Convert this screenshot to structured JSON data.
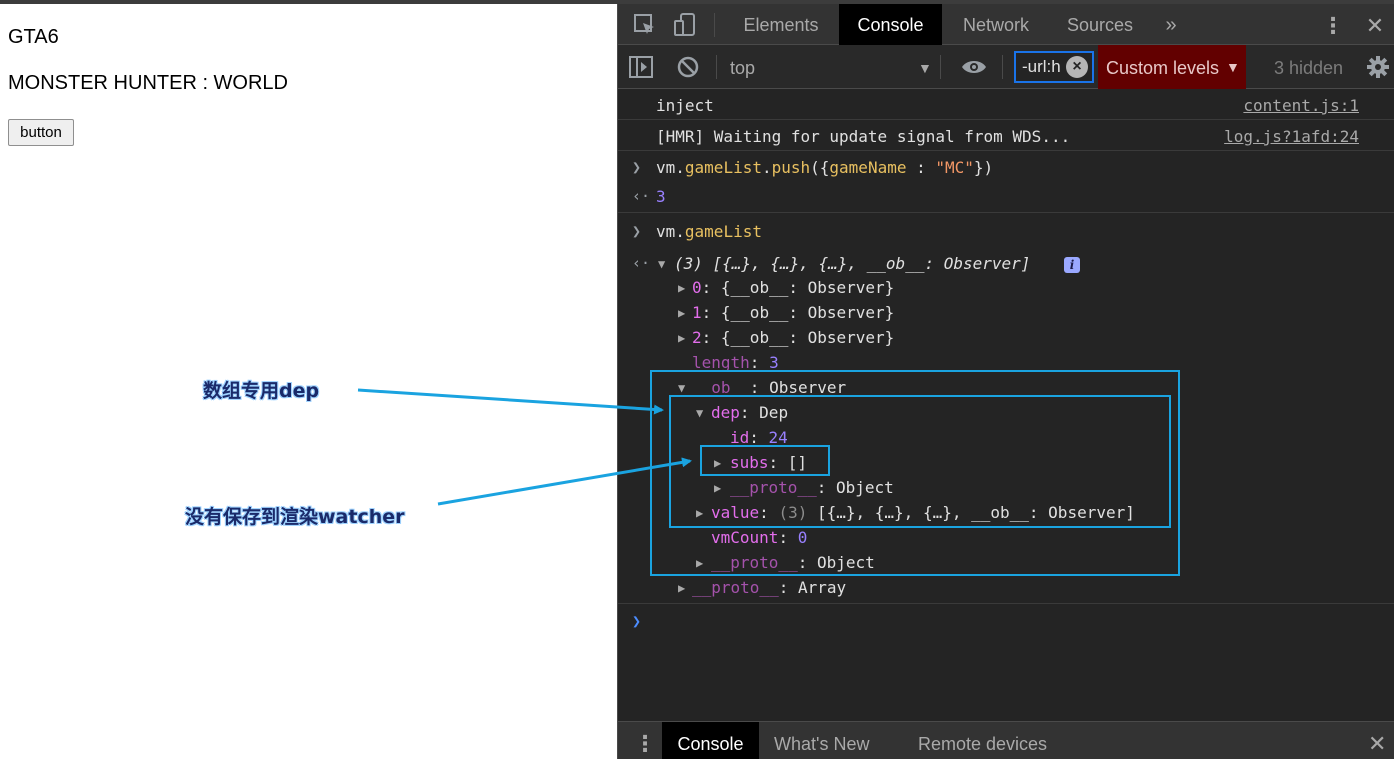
{
  "page": {
    "games": [
      "GTA6",
      "MONSTER HUNTER : WORLD"
    ],
    "button_label": "button"
  },
  "devtools": {
    "tabs": [
      "Elements",
      "Console",
      "Network",
      "Sources"
    ],
    "active_tab": "Console",
    "more_tabs_icon": "double-chevron-right-icon",
    "toolbar": {
      "context": "top",
      "filter_value": "-url:h",
      "levels_label": "Custom levels",
      "hidden_label": "3 hidden"
    },
    "console": {
      "logs": [
        {
          "message": "inject",
          "source": "content.js:1"
        },
        {
          "message": "[HMR] Waiting for update signal from WDS...",
          "source": "log.js?1afd:24"
        }
      ],
      "input1": {
        "obj": "vm.",
        "method": "gameList",
        "dot": ".",
        "call": "push",
        "args_open": "({",
        "key": "gameName",
        "colon": " : ",
        "value": "\"MC\"",
        "args_close": "})"
      },
      "result1": "3",
      "input2": {
        "obj": "vm.",
        "prop": "gameList"
      },
      "tree": {
        "summary": "(3) [{…}, {…}, {…}, __ob__: Observer]",
        "items": [
          {
            "key": "0",
            "value": "{__ob__: Observer}"
          },
          {
            "key": "1",
            "value": "{__ob__: Observer}"
          },
          {
            "key": "2",
            "value": "{__ob__: Observer}"
          }
        ],
        "length_key": "length",
        "length_value": "3",
        "ob_key": "__ob__",
        "ob_value": "Observer",
        "dep_key": "dep",
        "dep_value": "Dep",
        "id_key": "id",
        "id_value": "24",
        "subs_key": "subs",
        "subs_value": "[]",
        "proto_key": "__proto__",
        "proto_object": "Object",
        "value_key": "value",
        "value_count": "(3)",
        "value_value": "[{…}, {…}, {…}, __ob__: Observer]",
        "vmcount_key": "vmCount",
        "vmcount_value": "0",
        "proto_array": "Array"
      }
    },
    "drawer_tabs": [
      "Console",
      "What's New",
      "Remote devices"
    ]
  },
  "annotations": {
    "array_dep": "数组专用dep",
    "not_saved": "没有保存到渲染watcher"
  },
  "colors": {
    "annotation_line": "#1aa3e0",
    "levels_bg": "#620000"
  }
}
